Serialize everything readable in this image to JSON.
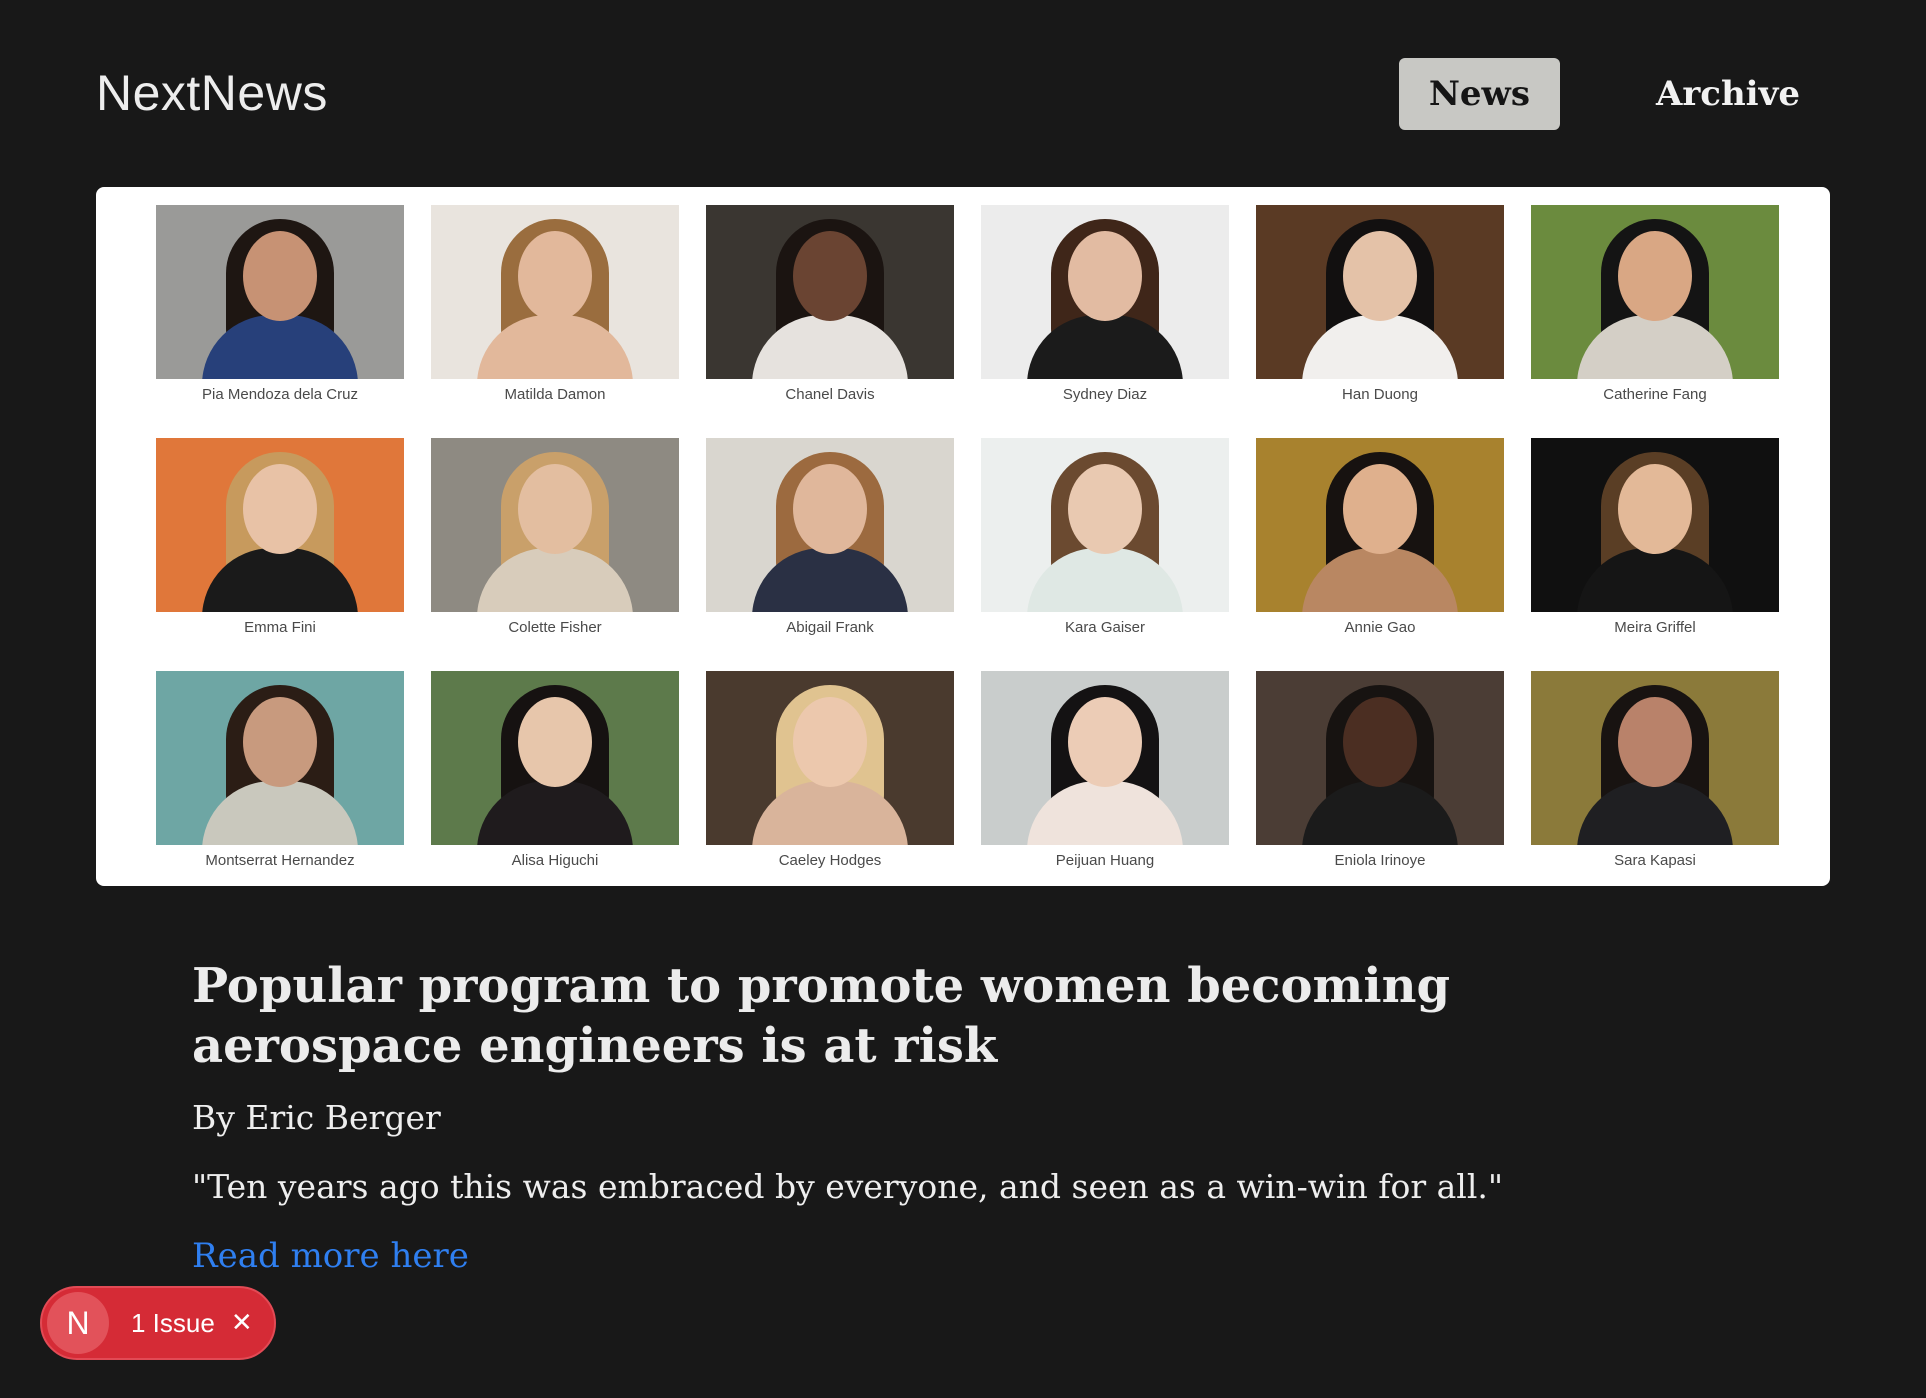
{
  "header": {
    "brand": "NextNews",
    "nav": [
      {
        "label": "News",
        "active": true
      },
      {
        "label": "Archive",
        "active": false
      }
    ]
  },
  "hero": {
    "people": [
      {
        "name": "Pia Mendoza dela Cruz",
        "bg": "#9a9a98",
        "skin": "#c79274",
        "hair": "#1e1612",
        "top": "#27407a"
      },
      {
        "name": "Matilda Damon",
        "bg": "#e9e4de",
        "skin": "#e2b89b",
        "hair": "#9a6d3e",
        "top": "#e2b89b"
      },
      {
        "name": "Chanel Davis",
        "bg": "#3a3631",
        "skin": "#6a4432",
        "hair": "#1b1411",
        "top": "#e6e2de"
      },
      {
        "name": "Sydney Diaz",
        "bg": "#ececec",
        "skin": "#e2bba2",
        "hair": "#3f2619",
        "top": "#1b1b1b"
      },
      {
        "name": "Han Duong",
        "bg": "#5a3a24",
        "skin": "#e4c2a8",
        "hair": "#121010",
        "top": "#f1efed"
      },
      {
        "name": "Catherine Fang",
        "bg": "#6b8b3e",
        "skin": "#d9a784",
        "hair": "#141414",
        "top": "#d4cfc6"
      },
      {
        "name": "Emma Fini",
        "bg": "#e0773a",
        "skin": "#e8c2a6",
        "hair": "#c79a5d",
        "top": "#1a1a1a"
      },
      {
        "name": "Colette Fisher",
        "bg": "#8e8a82",
        "skin": "#e3bea0",
        "hair": "#c9a06a",
        "top": "#d8ccbb"
      },
      {
        "name": "Abigail Frank",
        "bg": "#d9d6cf",
        "skin": "#e0b79b",
        "hair": "#9c6a3f",
        "top": "#2a3044"
      },
      {
        "name": "Kara Gaiser",
        "bg": "#ecefee",
        "skin": "#e9c9b1",
        "hair": "#6b4a30",
        "top": "#dfe8e4"
      },
      {
        "name": "Annie Gao",
        "bg": "#a8822e",
        "skin": "#dfb08d",
        "hair": "#171210",
        "top": "#b98762"
      },
      {
        "name": "Meira Griffel",
        "bg": "#101010",
        "skin": "#e3b998",
        "hair": "#5a3e25",
        "top": "#151515"
      },
      {
        "name": "Montserrat Hernandez",
        "bg": "#6ea6a4",
        "skin": "#c89a7e",
        "hair": "#2b1d15",
        "top": "#c9c8bd"
      },
      {
        "name": "Alisa Higuchi",
        "bg": "#5d7a4b",
        "skin": "#e7c6ab",
        "hair": "#161211",
        "top": "#1f1b1d"
      },
      {
        "name": "Caeley Hodges",
        "bg": "#4a3a2e",
        "skin": "#ecc8ad",
        "hair": "#e0c390",
        "top": "#d9b49b"
      },
      {
        "name": "Peijuan Huang",
        "bg": "#c9cdcc",
        "skin": "#ecccb6",
        "hair": "#141213",
        "top": "#efe3dc"
      },
      {
        "name": "Eniola Irinoye",
        "bg": "#4b3d35",
        "skin": "#4b2e22",
        "hair": "#171311",
        "top": "#1b1b1b"
      },
      {
        "name": "Sara Kapasi",
        "bg": "#8b7a3a",
        "skin": "#b9826a",
        "hair": "#181311",
        "top": "#1f1f22"
      }
    ]
  },
  "article": {
    "title": "Popular program to promote women becoming aerospace engineers is at risk",
    "byline": "By Eric Berger",
    "quote": "\"Ten years ago this was embraced by everyone, and seen as a win-win for all.\"",
    "read_more": "Read more here"
  },
  "issue_badge": {
    "logo": "N",
    "label": "1 Issue",
    "close_icon": "close-icon"
  },
  "colors": {
    "background": "#181818",
    "link": "#2f7ff0",
    "issue_red": "#d52b36",
    "nav_active": "#c8c8c4"
  }
}
